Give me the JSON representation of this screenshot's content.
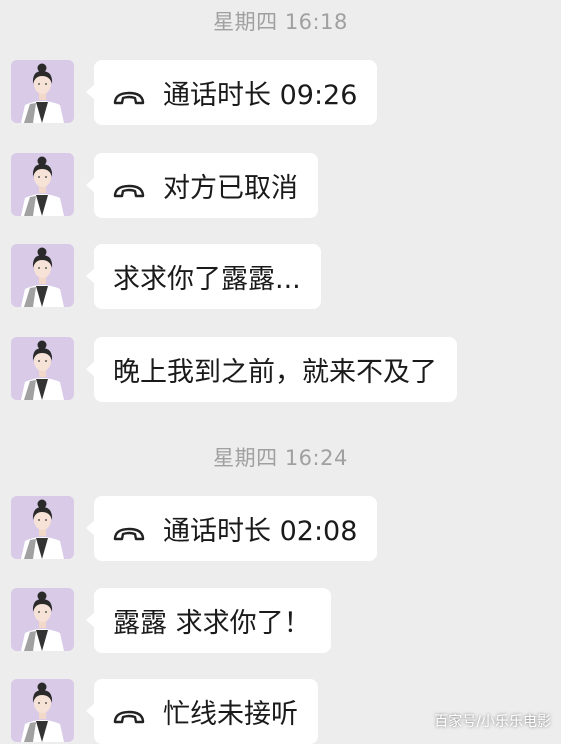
{
  "timestamps": [
    "星期四 16:18",
    "星期四 16:24"
  ],
  "messages": [
    {
      "kind": "call",
      "icon": "phone-hangup-icon",
      "text": "通话时长 09:26"
    },
    {
      "kind": "call",
      "icon": "phone-hangup-icon",
      "text": "对方已取消"
    },
    {
      "kind": "text",
      "text": "求求你了露露..."
    },
    {
      "kind": "text",
      "text": "晚上我到之前，就来不及了"
    },
    {
      "kind": "call",
      "icon": "phone-hangup-icon",
      "text": "通话时长 02:08"
    },
    {
      "kind": "text",
      "text": "露露 求求你了！"
    },
    {
      "kind": "call",
      "icon": "phone-hangup-icon",
      "text": "忙线未接听"
    }
  ],
  "watermark": "百家号/小乐乐电影",
  "colors": {
    "background": "#ededed",
    "bubble": "#ffffff",
    "timestamp": "#a0a0a0",
    "avatar_bg": "#d9cbe8"
  }
}
